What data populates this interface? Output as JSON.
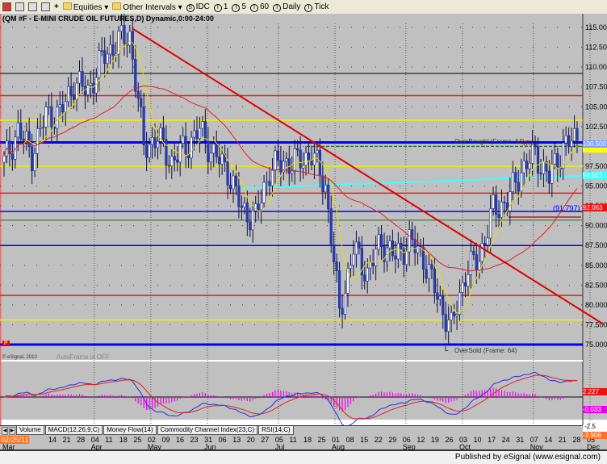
{
  "toolbar": {
    "equities": "Equities",
    "other_intervals": "Other Intervals",
    "idc": "IDC",
    "i1": "1",
    "i5": "5",
    "i60": "60",
    "daily": "Daily",
    "tick": "Tick"
  },
  "chart_title": "(QM #F - E-MINI CRUDE OIL FUTURES,D) Dynamic,0:00-24:00",
  "annotations": {
    "overbought": "OverBought (Frame: 64)",
    "oversold": "OverSold (Frame: 64)",
    "level": "(91.797)",
    "autoframe": "AutoFrame is OFF",
    "copyright": "© eSignal, 2010",
    "r": "(R)",
    "l": "L",
    "p": "P"
  },
  "price_tags": {
    "last": "100.500",
    "cyan": "96.027",
    "red": "92.063"
  },
  "macd_tags": {
    "macd": "2.227",
    "hist": "-0.033",
    "tick": "-2.5",
    "low": "-3.908"
  },
  "tabs": [
    "Volume",
    "MACD(12,26,9,C)",
    "Money Flow(14)",
    "Commodity Channel Index(23,C)",
    "RSI(14,C)"
  ],
  "footer": "Published by eSignal (www.esignal.com)",
  "colors": {
    "bg": "#c0c0c0",
    "up": "#ffffff",
    "down": "#2a3fb0",
    "ma_fast": "#e8e000",
    "ma_slow": "#e02020",
    "trend": "#e00000"
  },
  "chart_data": {
    "type": "candlestick",
    "title": "QM #F - E-MINI CRUDE OIL FUTURES, Daily",
    "start_date_label": "02/25/11",
    "x_tick_labels": [
      "14",
      "21",
      "28",
      "04",
      "11",
      "18",
      "25",
      "02",
      "09",
      "16",
      "23",
      "31",
      "06",
      "13",
      "20",
      "27",
      "05",
      "11",
      "18",
      "25",
      "01",
      "08",
      "15",
      "22",
      "29",
      "06",
      "12",
      "19",
      "26",
      "03",
      "10",
      "17",
      "24",
      "31",
      "07",
      "14",
      "21",
      "28",
      "05"
    ],
    "month_labels": [
      {
        "label": "Mar",
        "at": 0
      },
      {
        "label": "Apr",
        "at": 4
      },
      {
        "label": "May",
        "at": 8
      },
      {
        "label": "Jun",
        "at": 12
      },
      {
        "label": "Jul",
        "at": 17
      },
      {
        "label": "Aug",
        "at": 21
      },
      {
        "label": "Sep",
        "at": 26
      },
      {
        "label": "Oct",
        "at": 30
      },
      {
        "label": "Nov",
        "at": 35
      },
      {
        "label": "Dec",
        "at": 39
      }
    ],
    "weekly_close": [
      98,
      102,
      99,
      104,
      104,
      108,
      107,
      111,
      113,
      114,
      100,
      101,
      98,
      100,
      102,
      99,
      97,
      92,
      91,
      97,
      98,
      98,
      99,
      95,
      79,
      87,
      84,
      88,
      86,
      88,
      86,
      81,
      77,
      84,
      86,
      92,
      93,
      97,
      99,
      96,
      100,
      101
    ],
    "y_ticks": [
      115,
      112.5,
      110,
      107.5,
      105,
      102.5,
      100,
      97.5,
      95,
      92.5,
      90,
      87.5,
      85,
      82.5,
      80,
      77.5,
      75
    ],
    "ylim": [
      73,
      116
    ],
    "levels": [
      {
        "value": 109.2,
        "color": "#404040"
      },
      {
        "value": 106.4,
        "color": "#e02020"
      },
      {
        "value": 103.3,
        "color": "#f0f000"
      },
      {
        "value": 100.5,
        "color": "#0000ff"
      },
      {
        "value": 97.5,
        "color": "#f0f000"
      },
      {
        "value": 94.1,
        "color": "#e02020"
      },
      {
        "value": 91.8,
        "color": "#0000ff"
      },
      {
        "value": 90.7,
        "color": "#608060"
      },
      {
        "value": 87.5,
        "color": "#0000ff"
      },
      {
        "value": 81.2,
        "color": "#e02020"
      },
      {
        "value": 78.1,
        "color": "#f0f000"
      },
      {
        "value": 75,
        "color": "#0000ff"
      }
    ],
    "macd": {
      "params": "12,26,9",
      "ylim": [
        -4,
        4
      ]
    }
  }
}
